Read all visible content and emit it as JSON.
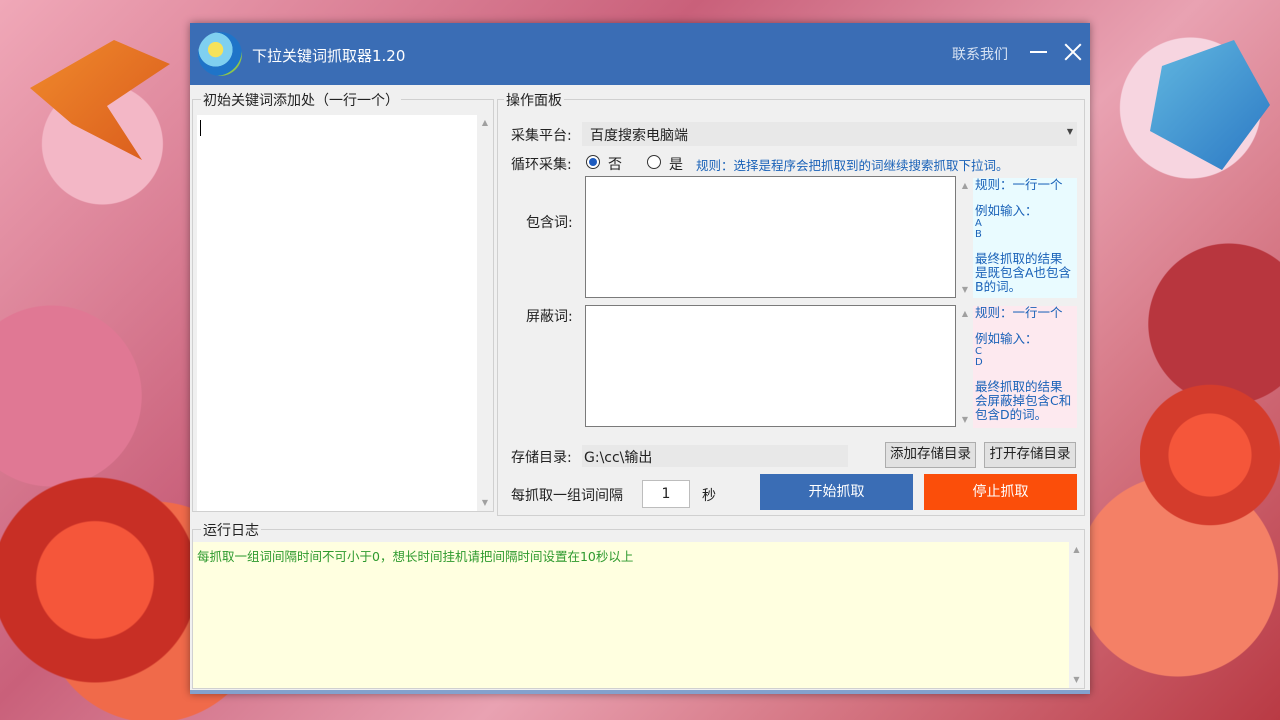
{
  "window": {
    "title": "下拉关键词抓取器1.20",
    "contact_label": "联系我们"
  },
  "keywords_panel": {
    "legend": "初始关键词添加处（一行一个）",
    "value": ""
  },
  "operation_panel": {
    "legend": "操作面板",
    "platform_label": "采集平台:",
    "platform_value": "百度搜索电脑端",
    "loop_label": "循环采集:",
    "loop_options": [
      {
        "label": "否",
        "checked": true
      },
      {
        "label": "是",
        "checked": false
      }
    ],
    "loop_rule": "规则：选择是程序会把抓取到的词继续搜索抓取下拉词。",
    "include_label": "包含词:",
    "include_hint": {
      "rule": "规则：一行一个",
      "example": "例如输入：",
      "items": [
        "A",
        "B"
      ],
      "result": [
        "最终抓取的结果",
        "是既包含A也包含",
        "B的词。"
      ]
    },
    "exclude_label": "屏蔽词:",
    "exclude_hint": {
      "rule": "规则：一行一个",
      "example": "例如输入：",
      "items": [
        "C",
        "D"
      ],
      "result": [
        "最终抓取的结果",
        "会屏蔽掉包含C和",
        "包含D的词。"
      ]
    },
    "storage_label": "存储目录:",
    "storage_path": "G:\\cc\\输出",
    "add_dir_button": "添加存储目录",
    "open_dir_button": "打开存储目录",
    "interval_label": "每抓取一组词间隔",
    "interval_value": "1",
    "interval_unit": "秒",
    "start_button": "开始抓取",
    "stop_button": "停止抓取"
  },
  "log_panel": {
    "legend": "运行日志",
    "lines": [
      "每抓取一组词间隔时间不可小于0，想长时间挂机请把间隔时间设置在10秒以上"
    ]
  },
  "colors": {
    "titlebar": "#3a6db5",
    "start_button": "#3a6db5",
    "stop_button": "#fb4e0a",
    "rule_text": "#1a62b8",
    "log_text": "#2e9a2e",
    "log_bg": "#ffffe0"
  },
  "icons": {
    "app": "app-logo-icon",
    "minimize": "minimize-icon",
    "close": "close-icon",
    "dropdown": "chevron-down-icon",
    "scroll_up": "arrow-up-icon",
    "scroll_down": "arrow-down-icon"
  }
}
